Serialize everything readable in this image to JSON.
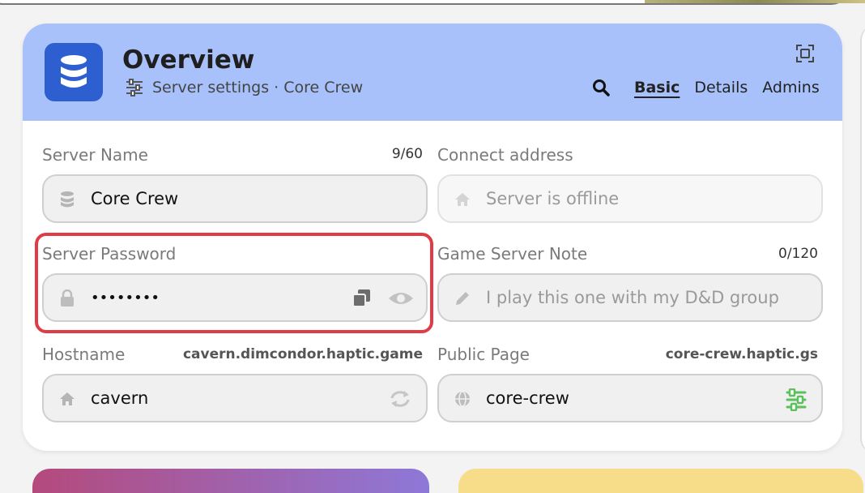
{
  "header": {
    "title": "Overview",
    "subtitle": "Server settings · Core Crew",
    "tabs": [
      {
        "label": "Basic",
        "active": true
      },
      {
        "label": "Details",
        "active": false
      },
      {
        "label": "Admins",
        "active": false
      }
    ],
    "accent_color": "#a8c1fa",
    "icon_color": "#2d5fd0"
  },
  "fields": {
    "server_name": {
      "label": "Server Name",
      "counter": "9/60",
      "value": "Core Crew"
    },
    "connect_address": {
      "label": "Connect address",
      "placeholder": "Server is offline"
    },
    "server_password": {
      "label": "Server Password",
      "value": "••••••••"
    },
    "game_server_note": {
      "label": "Game Server Note",
      "counter": "0/120",
      "placeholder": "I play this one with my D&D group"
    },
    "hostname": {
      "label": "Hostname",
      "hint": "cavern.dimcondor.haptic.game",
      "value": "cavern"
    },
    "public_page": {
      "label": "Public Page",
      "hint": "core-crew.haptic.gs",
      "value": "core-crew"
    }
  },
  "highlight_color": "#e03c45"
}
